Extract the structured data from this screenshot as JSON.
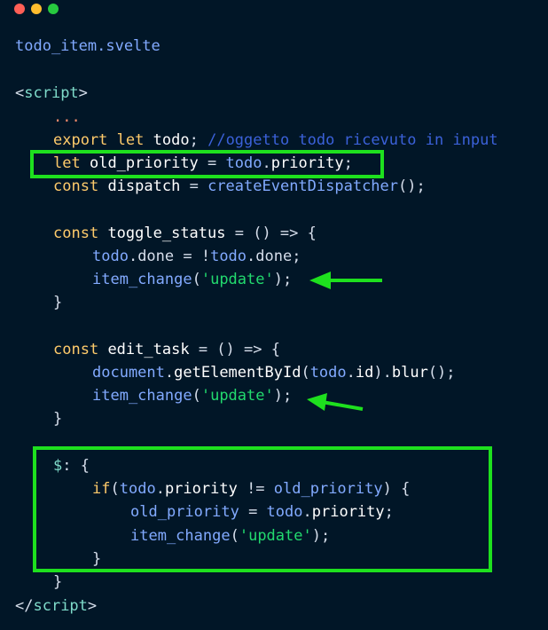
{
  "window": {
    "controls": [
      "close",
      "minimize",
      "maximize"
    ],
    "filename": "todo_item.svelte"
  },
  "code": {
    "script_open": {
      "lt": "<",
      "tag": "script",
      "gt": ">"
    },
    "ellipsis": "...",
    "l_export": {
      "kw1": "export",
      "kw2": "let",
      "name": "todo",
      "semi": ";",
      "comment": "//oggetto todo ricevuto in input"
    },
    "l_oldprio": {
      "kw": "let",
      "name": "old_priority",
      "eq": "=",
      "obj": "todo",
      "dot": ".",
      "prop": "priority",
      "semi": ";"
    },
    "l_dispatch": {
      "kw": "const",
      "name": "dispatch",
      "eq": "=",
      "fn": "createEventDispatcher",
      "call": "();"
    },
    "l_toggle": {
      "kw": "const",
      "name": "toggle_status",
      "rest": "= () => {"
    },
    "l_done": {
      "obj1": "todo",
      "mid": ".done = !",
      "obj2": "todo",
      "end": ".done;"
    },
    "l_item1": {
      "fn": "item_change",
      "open": "(",
      "str": "'update'",
      "close": ");"
    },
    "brace1": "}",
    "l_edit": {
      "kw": "const",
      "name": "edit_task",
      "rest": "= () => {"
    },
    "l_doc": {
      "obj": "document",
      "dot1": ".",
      "fn": "getElementById",
      "open": "(",
      "obj2": "todo",
      "dot2": ".",
      "prop": "id",
      "close": ").",
      "fn2": "blur",
      "end": "();"
    },
    "l_item2": {
      "fn": "item_change",
      "open": "(",
      "str": "'update'",
      "close": ");"
    },
    "brace2": "}",
    "l_reactive": {
      "label": "$",
      "rest": ": {"
    },
    "l_if": {
      "kw": "if",
      "open": "(",
      "obj": "todo",
      "dot": ".",
      "prop": "priority",
      "op": " != ",
      "var": "old_priority",
      "close": ") {"
    },
    "l_assign": {
      "var": "old_priority",
      "eq": " = ",
      "obj": "todo",
      "dot": ".",
      "prop": "priority",
      "semi": ";"
    },
    "l_item3": {
      "fn": "item_change",
      "open": "(",
      "str": "'update'",
      "close": ");"
    },
    "brace3": "}",
    "brace4": "}",
    "script_close": {
      "lt": "</",
      "tag": "script",
      "gt": ">"
    }
  },
  "colors": {
    "background": "#011627",
    "highlight": "#1ee01e"
  }
}
